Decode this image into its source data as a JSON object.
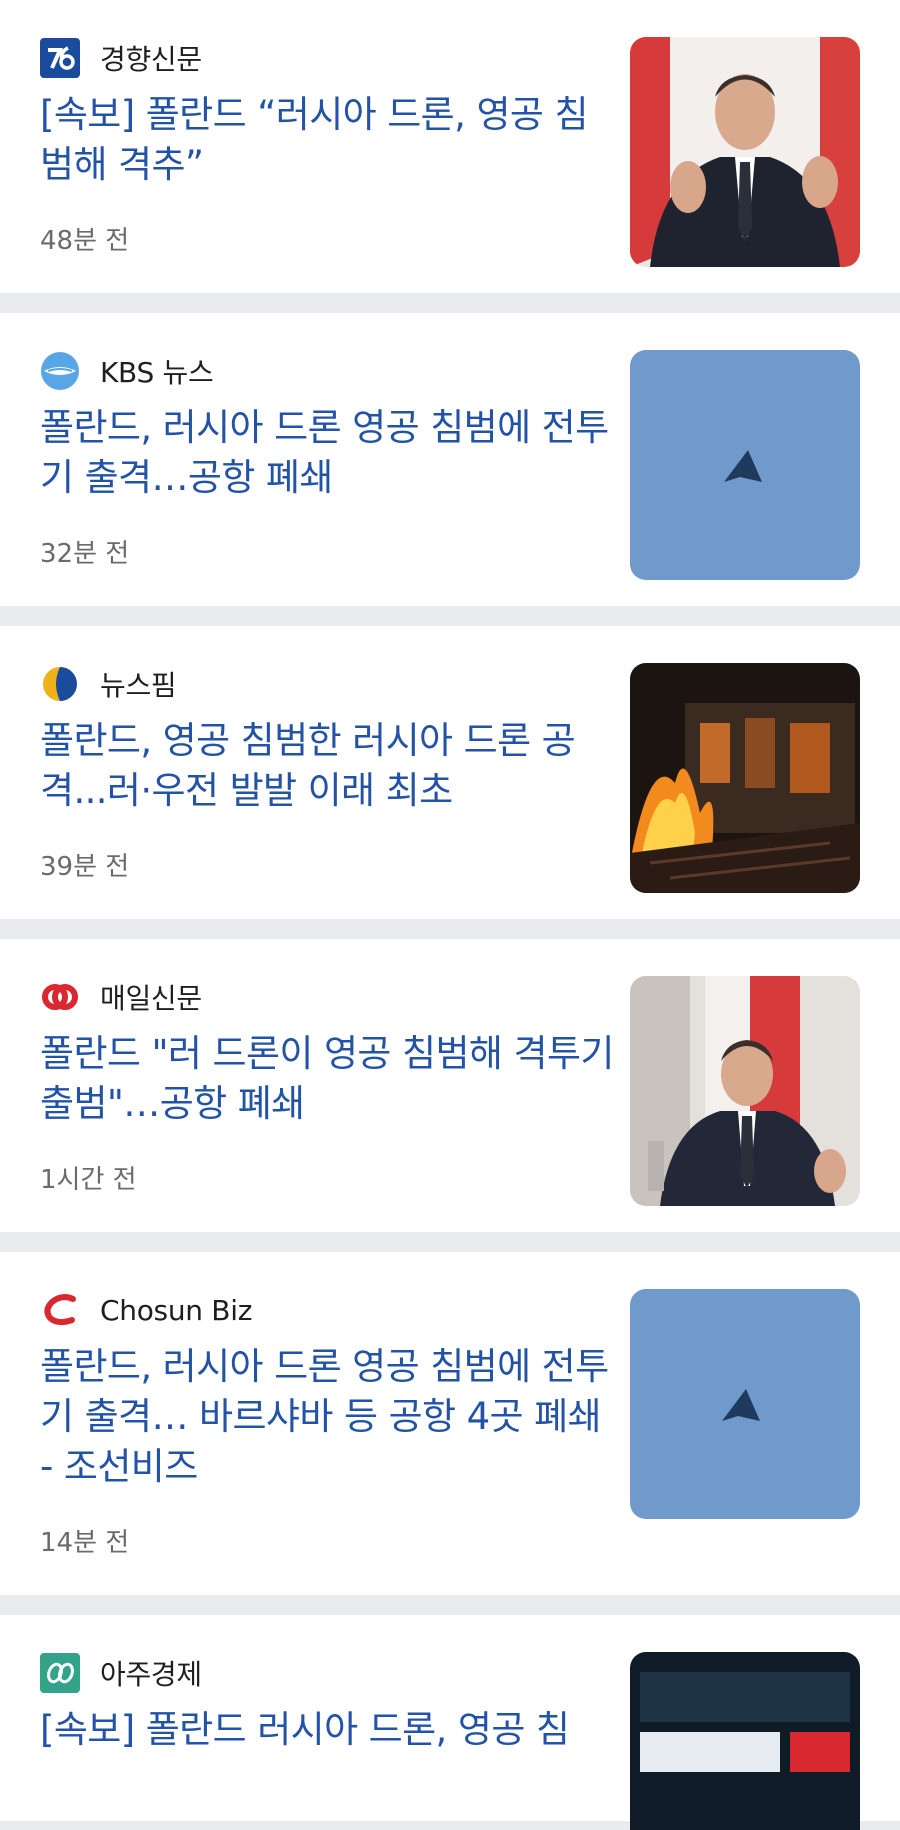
{
  "articles": [
    {
      "source": "경향신문",
      "headline": "[속보] 폴란드 “러시아 드론, 영공 침범해 격추”",
      "time": "48분 전"
    },
    {
      "source": "KBS 뉴스",
      "headline": "폴란드, 러시아 드론 영공 침범에 전투기 출격…공항 폐쇄",
      "time": "32분 전"
    },
    {
      "source": "뉴스핌",
      "headline": "폴란드, 영공 침범한 러시아 드론 공격...러·우전 발발 이래 최초",
      "time": "39분 전"
    },
    {
      "source": "매일신문",
      "headline": "폴란드 \"러 드론이 영공 침범해 격투기 출범\"…공항 폐쇄",
      "time": "1시간 전"
    },
    {
      "source": "Chosun Biz",
      "headline": "폴란드, 러시아 드론 영공 침범에 전투기 출격… 바르샤바 등 공항 4곳 폐쇄 - 조선비즈",
      "time": "14분 전"
    },
    {
      "source": "아주경제",
      "headline": "[속보] 폴란드 러시아 드론, 영공 침",
      "time": ""
    }
  ],
  "colors": {
    "headline": "#2253a6",
    "source": "#1f1f1f",
    "time": "#6b6b6b",
    "separator": "#e9ebee",
    "sky_thumb": "#6f9acb"
  },
  "icons": [
    "kyunghyang-logo",
    "kbs-logo",
    "newspim-logo",
    "maeil-logo",
    "chosunbiz-logo",
    "aju-logo"
  ]
}
